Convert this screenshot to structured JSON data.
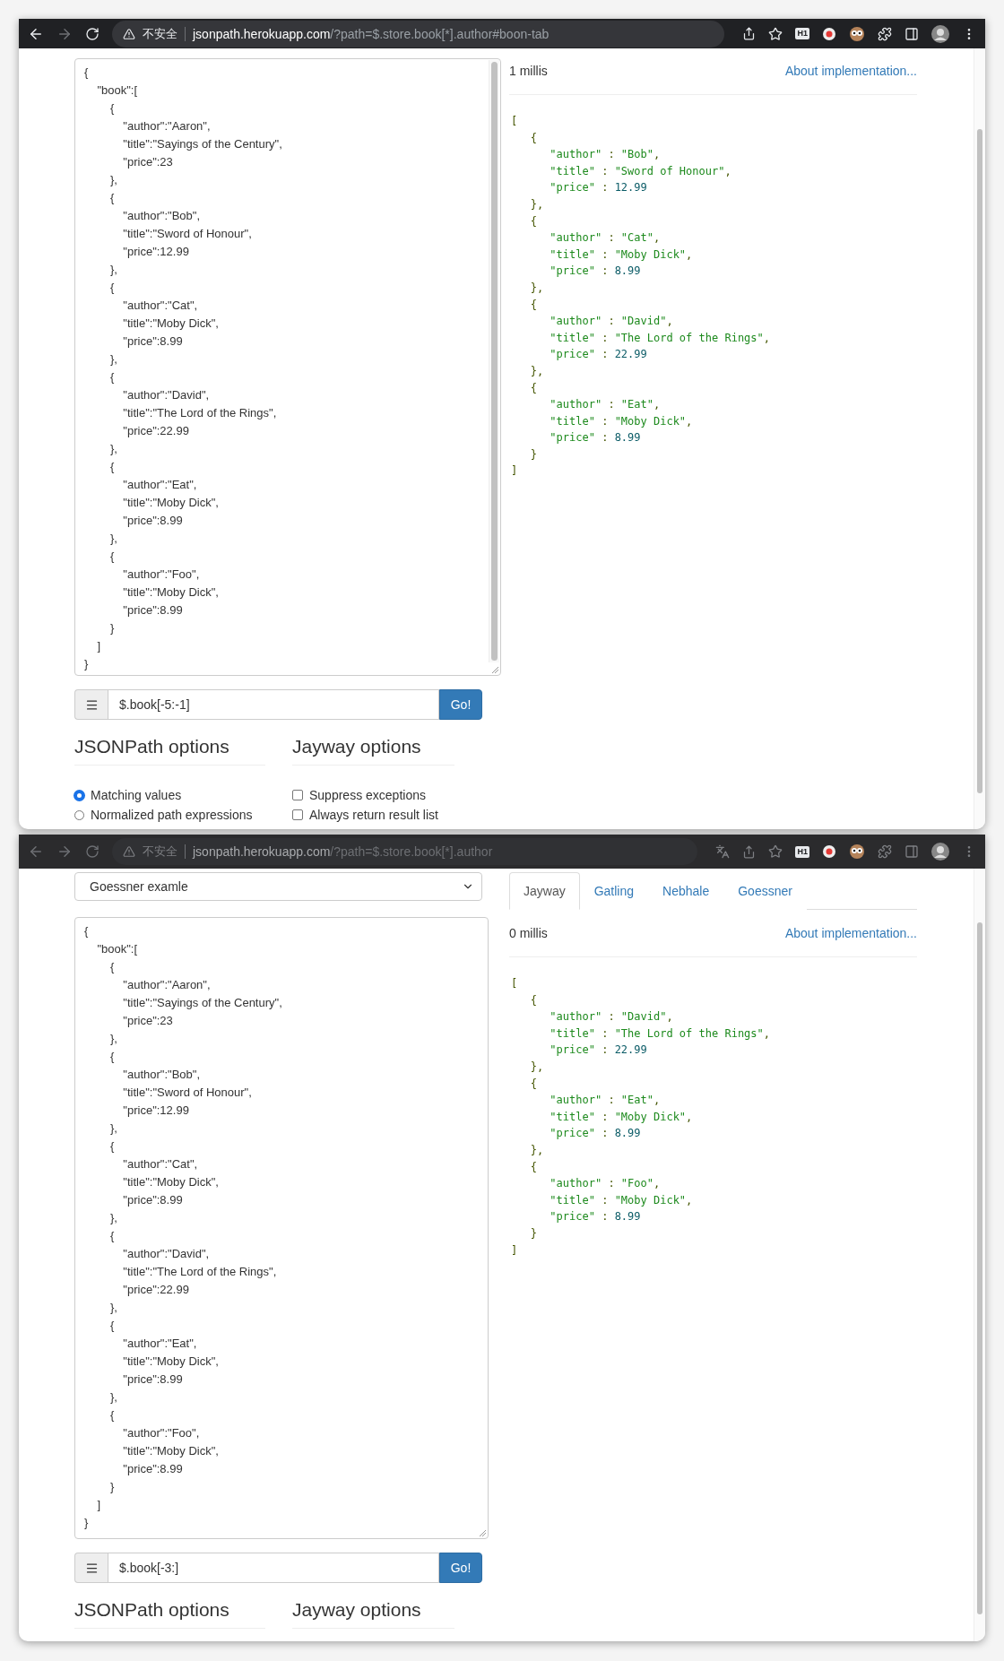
{
  "windows": [
    {
      "active": true,
      "toolbar": {
        "security": "不安全",
        "host": "jsonpath.herokuapp.com",
        "path": "/?path=$.store.book[*].author#boon-tab",
        "extensions": [
          {
            "kind": "share"
          },
          {
            "kind": "star"
          },
          {
            "kind": "badge",
            "label": "H1"
          },
          {
            "kind": "record"
          },
          {
            "kind": "owl"
          },
          {
            "kind": "puzzle"
          },
          {
            "kind": "sidebar"
          },
          {
            "kind": "avatar"
          },
          {
            "kind": "menu"
          }
        ]
      },
      "editor": {
        "scrollbar": true,
        "text": "{\n    \"book\":[\n        {\n            \"author\":\"Aaron\",\n            \"title\":\"Sayings of the Century\",\n            \"price\":23\n        },\n        {\n            \"author\":\"Bob\",\n            \"title\":\"Sword of Honour\",\n            \"price\":12.99\n        },\n        {\n            \"author\":\"Cat\",\n            \"title\":\"Moby Dick\",\n            \"price\":8.99\n        },\n        {\n            \"author\":\"David\",\n            \"title\":\"The Lord of the Rings\",\n            \"price\":22.99\n        },\n        {\n            \"author\":\"Eat\",\n            \"title\":\"Moby Dick\",\n            \"price\":8.99\n        },\n        {\n            \"author\":\"Foo\",\n            \"title\":\"Moby Dick\",\n            \"price\":8.99\n        }\n    ]\n}"
      },
      "query": {
        "value": "$.book[-5:-1]",
        "button": "Go!"
      },
      "option_groups": [
        {
          "title": "JSONPath options",
          "options": [
            {
              "kind": "radio",
              "label": "Matching values",
              "selected": true
            },
            {
              "kind": "radio",
              "label": "Normalized path expressions",
              "selected": false
            }
          ]
        },
        {
          "title": "Jayway options",
          "options": [
            {
              "kind": "checkbox",
              "label": "Suppress exceptions",
              "checked": false
            },
            {
              "kind": "checkbox",
              "label": "Always return result list",
              "checked": false
            }
          ]
        }
      ],
      "timing": "1 millis",
      "about_link": "About implementation...",
      "result": "[\n   {\n      \"author\" : \"Bob\",\n      \"title\" : \"Sword of Honour\",\n      \"price\" : 12.99\n   },\n   {\n      \"author\" : \"Cat\",\n      \"title\" : \"Moby Dick\",\n      \"price\" : 8.99\n   },\n   {\n      \"author\" : \"David\",\n      \"title\" : \"The Lord of the Rings\",\n      \"price\" : 22.99\n   },\n   {\n      \"author\" : \"Eat\",\n      \"title\" : \"Moby Dick\",\n      \"price\" : 8.99\n   }\n]"
    },
    {
      "active": false,
      "toolbar": {
        "security": "不安全",
        "host": "jsonpath.herokuapp.com",
        "path": "/?path=$.store.book[*].author",
        "extensions": [
          {
            "kind": "translate"
          },
          {
            "kind": "share"
          },
          {
            "kind": "star"
          },
          {
            "kind": "badge",
            "label": "H1"
          },
          {
            "kind": "record"
          },
          {
            "kind": "owl"
          },
          {
            "kind": "puzzle"
          },
          {
            "kind": "sidebar"
          },
          {
            "kind": "avatar"
          },
          {
            "kind": "menu"
          }
        ]
      },
      "selector": {
        "value": "Goessner examle"
      },
      "tabs": [
        {
          "label": "Jayway",
          "selected": true
        },
        {
          "label": "Gatling",
          "selected": false
        },
        {
          "label": "Nebhale",
          "selected": false
        },
        {
          "label": "Goessner",
          "selected": false
        }
      ],
      "editor": {
        "scrollbar": false,
        "text": "{\n    \"book\":[\n        {\n            \"author\":\"Aaron\",\n            \"title\":\"Sayings of the Century\",\n            \"price\":23\n        },\n        {\n            \"author\":\"Bob\",\n            \"title\":\"Sword of Honour\",\n            \"price\":12.99\n        },\n        {\n            \"author\":\"Cat\",\n            \"title\":\"Moby Dick\",\n            \"price\":8.99\n        },\n        {\n            \"author\":\"David\",\n            \"title\":\"The Lord of the Rings\",\n            \"price\":22.99\n        },\n        {\n            \"author\":\"Eat\",\n            \"title\":\"Moby Dick\",\n            \"price\":8.99\n        },\n        {\n            \"author\":\"Foo\",\n            \"title\":\"Moby Dick\",\n            \"price\":8.99\n        }\n    ]\n}"
      },
      "query": {
        "value": "$.book[-3:]",
        "button": "Go!"
      },
      "option_groups": [
        {
          "title": "JSONPath options"
        },
        {
          "title": "Jayway options"
        }
      ],
      "timing": "0 millis",
      "about_link": "About implementation...",
      "result": "[\n   {\n      \"author\" : \"David\",\n      \"title\" : \"The Lord of the Rings\",\n      \"price\" : 22.99\n   },\n   {\n      \"author\" : \"Eat\",\n      \"title\" : \"Moby Dick\",\n      \"price\" : 8.99\n   },\n   {\n      \"author\" : \"Foo\",\n      \"title\" : \"Moby Dick\",\n      \"price\" : 8.99\n   }\n]"
    }
  ]
}
